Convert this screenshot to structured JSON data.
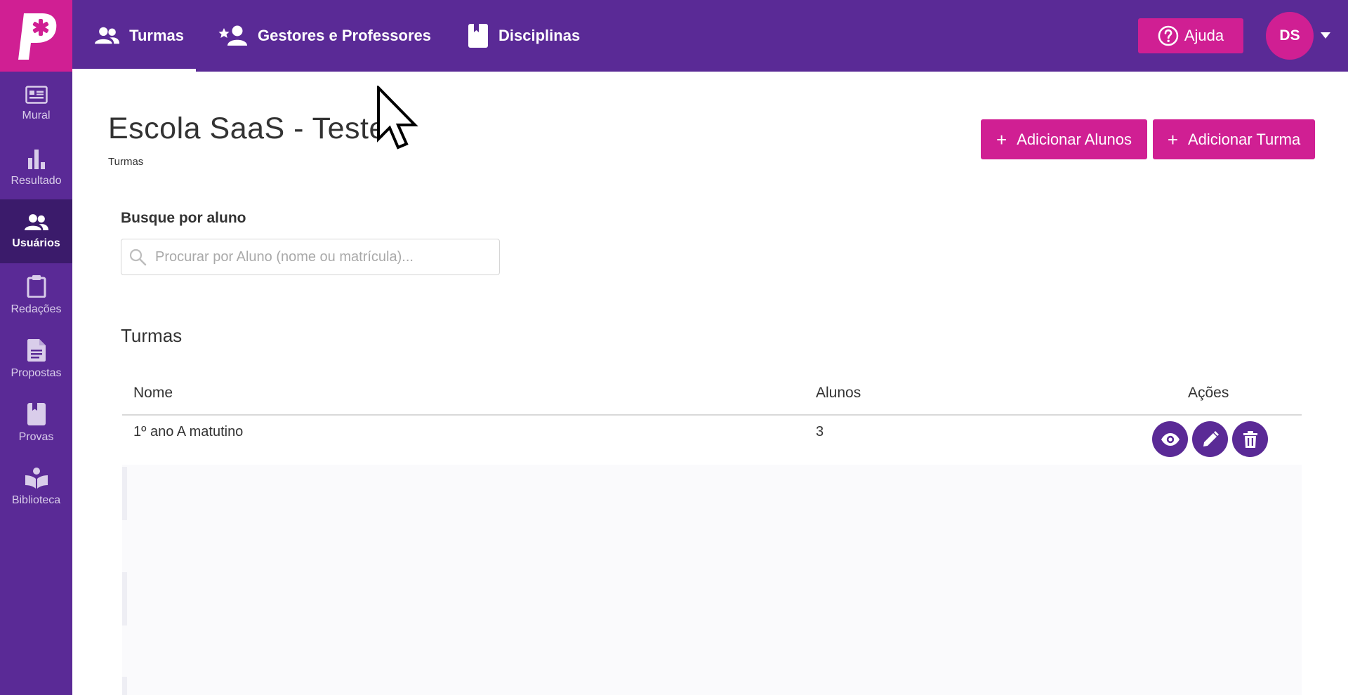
{
  "topnav": {
    "tabs": [
      {
        "label": "Turmas",
        "active": true
      },
      {
        "label": "Gestores e Professores",
        "active": false
      },
      {
        "label": "Disciplinas",
        "active": false
      }
    ],
    "help_label": "Ajuda",
    "user_initials": "DS"
  },
  "sidebar": {
    "items": [
      {
        "label": "Mural",
        "icon": "mural-icon",
        "active": false
      },
      {
        "label": "Resultado",
        "icon": "bar-chart-icon",
        "active": false
      },
      {
        "label": "Usuários",
        "icon": "users-icon",
        "active": true
      },
      {
        "label": "Redações",
        "icon": "clipboard-icon",
        "active": false
      },
      {
        "label": "Propostas",
        "icon": "document-icon",
        "active": false
      },
      {
        "label": "Provas",
        "icon": "book-icon",
        "active": false
      },
      {
        "label": "Biblioteca",
        "icon": "library-icon",
        "active": false
      }
    ]
  },
  "main": {
    "title": "Escola SaaS - Teste",
    "breadcrumb": "Turmas",
    "add_students_label": "Adicionar Alunos",
    "add_class_label": "Adicionar Turma",
    "search": {
      "label": "Busque por aluno",
      "placeholder": "Procurar por Aluno (nome ou matrícula)...",
      "value": ""
    },
    "section_title": "Turmas",
    "table": {
      "columns": [
        "Nome",
        "Alunos",
        "Ações"
      ],
      "rows": [
        {
          "nome": "1º ano A matutino",
          "alunos": "3"
        }
      ]
    }
  },
  "colors": {
    "brand_purple": "#5a2a96",
    "brand_purple_dark": "#3b1b6b",
    "accent_pink": "#d01f93"
  }
}
